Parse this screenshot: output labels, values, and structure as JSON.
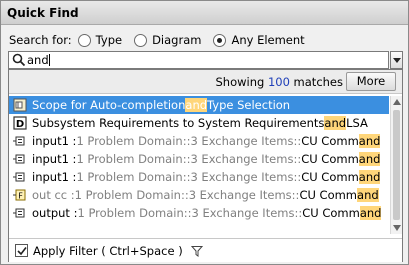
{
  "window": {
    "title": "Quick Find"
  },
  "search_for": {
    "label": "Search for:",
    "options": [
      {
        "label": "Type",
        "checked": false
      },
      {
        "label": "Diagram",
        "checked": false
      },
      {
        "label": "Any Element",
        "checked": true
      }
    ]
  },
  "query": {
    "value": "and",
    "icon": "search-icon"
  },
  "results_header": {
    "prefix": "Showing ",
    "count": "100",
    "suffix": " matches",
    "more_label": "More"
  },
  "results": [
    {
      "icon": "scope-icon",
      "parts": [
        {
          "t": "Scope for Auto-completion ",
          "c": "n"
        },
        {
          "t": "and",
          "c": "h"
        },
        {
          "t": " Type Selection",
          "c": "n"
        }
      ],
      "selected": true
    },
    {
      "icon": "diagram-d-icon",
      "parts": [
        {
          "t": "Subsystem Requirements to System Requirements ",
          "c": "n"
        },
        {
          "t": "and",
          "c": "h"
        },
        {
          "t": " LSA",
          "c": "n"
        }
      ],
      "selected": false
    },
    {
      "icon": "port-icon",
      "parts": [
        {
          "t": "input1 : ",
          "c": "n"
        },
        {
          "t": "1 Problem Domain::3 Exchange Items::",
          "c": "g"
        },
        {
          "t": "CU Comm",
          "c": "n"
        },
        {
          "t": "and",
          "c": "h"
        }
      ],
      "selected": false
    },
    {
      "icon": "port-icon",
      "parts": [
        {
          "t": "input1 : ",
          "c": "n"
        },
        {
          "t": "1 Problem Domain::3 Exchange Items::",
          "c": "g"
        },
        {
          "t": "CU Comm",
          "c": "n"
        },
        {
          "t": "and",
          "c": "h"
        }
      ],
      "selected": false
    },
    {
      "icon": "port-icon",
      "parts": [
        {
          "t": "input1 : ",
          "c": "n"
        },
        {
          "t": "1 Problem Domain::3 Exchange Items::",
          "c": "g"
        },
        {
          "t": "CU Comm",
          "c": "n"
        },
        {
          "t": "and",
          "c": "h"
        }
      ],
      "selected": false
    },
    {
      "icon": "flow-f-icon",
      "parts": [
        {
          "t": "out cc : ",
          "c": "g"
        },
        {
          "t": "1 Problem Domain::3 Exchange Items::",
          "c": "g"
        },
        {
          "t": "CU Comm",
          "c": "n"
        },
        {
          "t": "and",
          "c": "h"
        }
      ],
      "selected": false
    },
    {
      "icon": "port-icon",
      "parts": [
        {
          "t": "output : ",
          "c": "n"
        },
        {
          "t": "1 Problem Domain::3 Exchange Items::",
          "c": "g"
        },
        {
          "t": "CU Comm",
          "c": "n"
        },
        {
          "t": "and",
          "c": "h"
        }
      ],
      "selected": false
    }
  ],
  "filter": {
    "label": "Apply Filter ( Ctrl+Space )",
    "checked": true,
    "icon": "funnel-icon"
  },
  "colors": {
    "selection": "#3b8fe0",
    "highlight": "#ffd67a",
    "count": "#1f3fb8"
  }
}
